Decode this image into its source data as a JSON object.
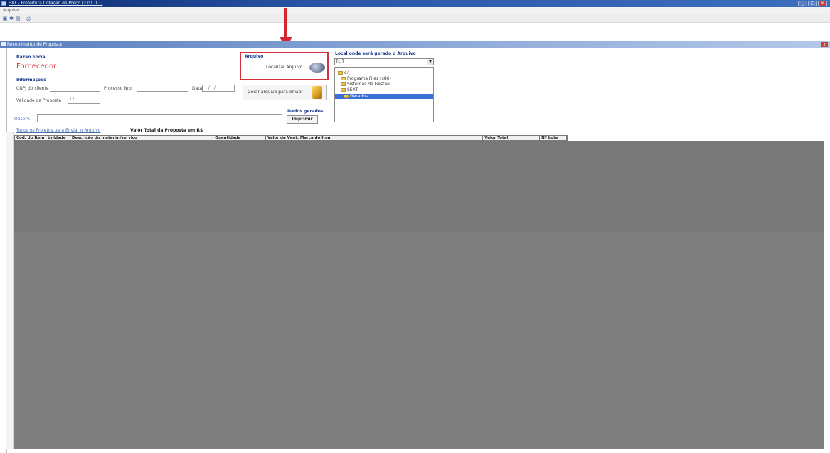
{
  "window": {
    "title": "EXT - Prefeitura Cotação de Preço [2.01.0.1]"
  },
  "menu": {
    "items": [
      "Arquivo"
    ]
  },
  "toolbar": {
    "icons": [
      "save-icon",
      "refresh-icon",
      "edit-icon",
      "print-icon"
    ]
  },
  "subwindow": {
    "title": "Recebimento de Proposta",
    "close_label": "x"
  },
  "form": {
    "razao_social_label": "Razão Social",
    "fornecedor_value": "Fornecedor",
    "informacoes_label": "Informações",
    "cnpj_label": "CNPJ do cliente",
    "processo_label": "Processo Nro",
    "data_label": "Data",
    "data_value": "__/__/__",
    "validade_label": "Validade da Proposta",
    "validade_value": "/ /",
    "arquivo_label": "Arquivo",
    "localizar_label": "Localizar Arquivo",
    "enviar_label": "Gerar arquivo para enviar",
    "dados_label": "Dados gerados",
    "imprimir_label": "Imprimir",
    "local_label": "Local onde será gerado o Arquivo",
    "drive_value": "[c:]",
    "obs_label": "Observ."
  },
  "tree": {
    "items": [
      "c:\\",
      "Programa Files (x86)",
      "Sistemas de Gestao",
      "SEXT",
      "Gerados"
    ],
    "selected_index": 4
  },
  "grid": {
    "caption_link": "Todos os Projetos para Enviar o Arquivo",
    "caption_total": "Valor Total da Proposta em R$",
    "columns": [
      "Cod. do Item",
      "Unidade",
      "Descrição do material/serviço",
      "Quantidade",
      "Valor da Vent. Marca do Item",
      "Valor Total",
      "Nº Lote"
    ]
  },
  "colors": {
    "titlebar": "#0a2a6e",
    "accent_red": "#d8262e",
    "grid_bg": "#7f7f7f",
    "selection": "#3a6fd8"
  }
}
